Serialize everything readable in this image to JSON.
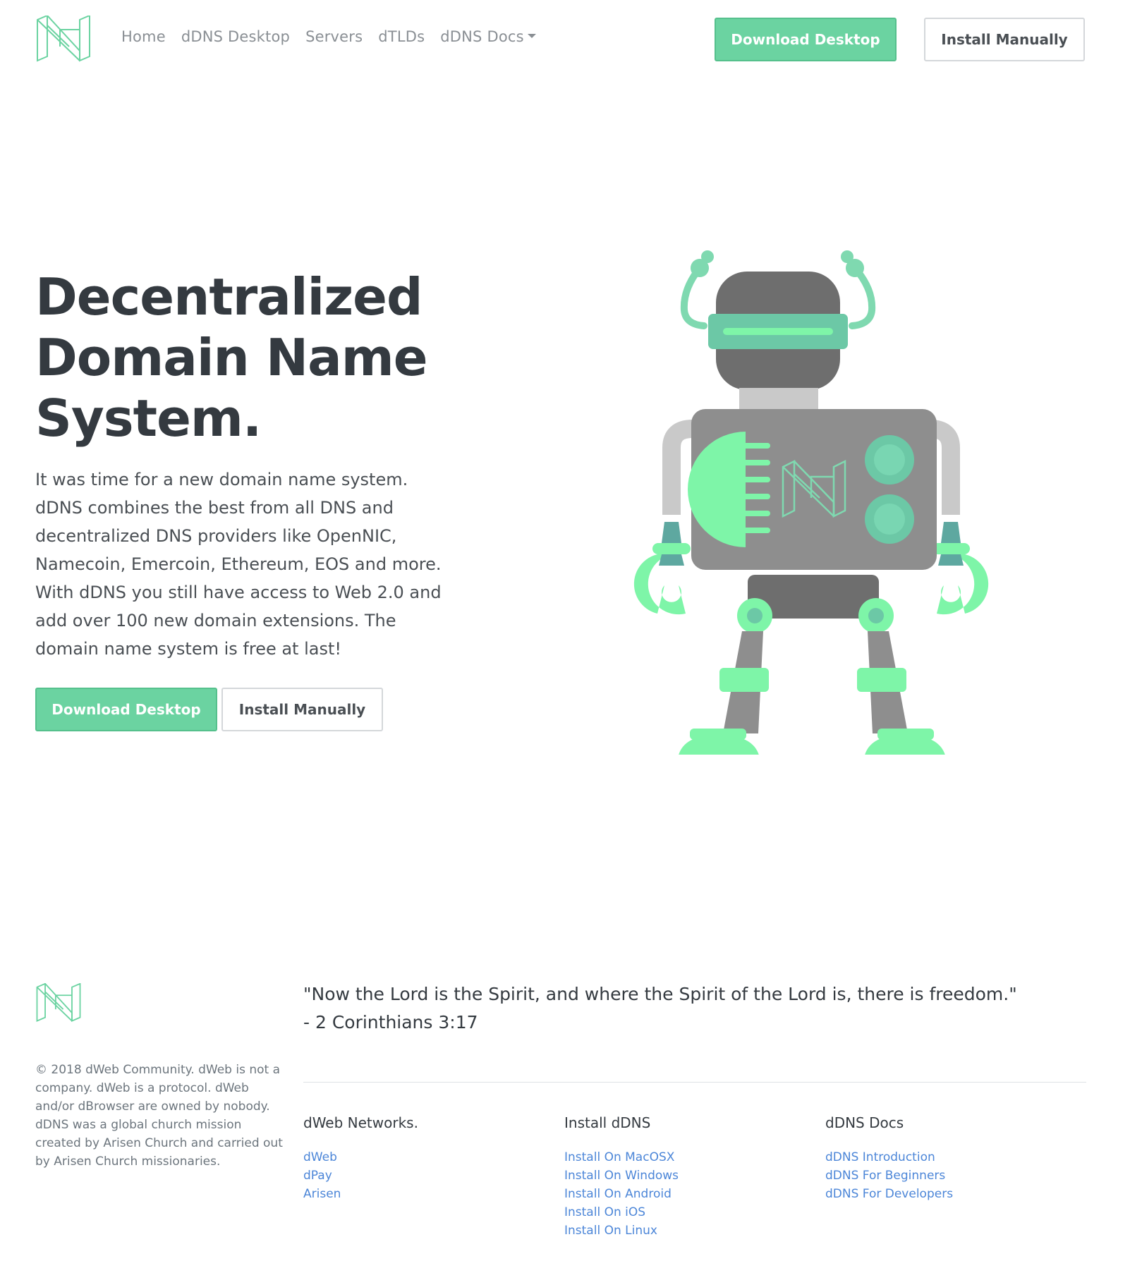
{
  "nav": {
    "links": [
      "Home",
      "dDNS Desktop",
      "Servers",
      "dTLDs",
      "dDNS Docs"
    ],
    "download_label": "Download Desktop",
    "install_label": "Install Manually"
  },
  "hero": {
    "title_lines": [
      "Decentralized",
      "Domain Name",
      "System."
    ],
    "text": "It was time for a new domain name system. dDNS combines the best from all DNS and decentralized DNS providers like OpenNIC, Namecoin, Emercoin, Ethereum, EOS and more. With dDNS you still have access to Web 2.0 and add over 100 new domain extensions. The domain name system is free at last!",
    "download_label": "Download Desktop",
    "install_label": "Install Manually"
  },
  "footer": {
    "copyright": "© 2018 dWeb Community. dWeb is not a company. dWeb is a protocol. dWeb and/or dBrowser are owned by nobody. dDNS was a global church mission created by Arisen Church and carried out by Arisen Church missionaries.",
    "quote_line1": "\"Now the Lord is the Spirit, and where the Spirit of the Lord is, there is freedom.\"",
    "quote_line2": "- 2 Corinthians 3:17",
    "columns": [
      {
        "title": "dWeb Networks.",
        "links": [
          "dWeb",
          "dPay",
          "Arisen"
        ]
      },
      {
        "title": "Install dDNS",
        "links": [
          "Install On MacOSX",
          "Install On Windows",
          "Install On Android",
          "Install On iOS",
          "Install On Linux"
        ]
      },
      {
        "title": "dDNS Docs",
        "links": [
          "dDNS Introduction",
          "dDNS For Beginners",
          "dDNS For Developers"
        ]
      }
    ]
  },
  "colors": {
    "accent": "#6bd3a1",
    "link": "#4c86d8",
    "heading": "#343a40",
    "robot_green": "#7ef5a8",
    "robot_teal": "#6cc8a6",
    "robot_gray": "#8e8e8e",
    "robot_dark": "#6e6e6e",
    "robot_light": "#c9c9c9"
  },
  "icons": {
    "brand_logo": "dweb-logo-icon",
    "robot": "robot-illustration",
    "dropdown": "caret-down-icon"
  }
}
